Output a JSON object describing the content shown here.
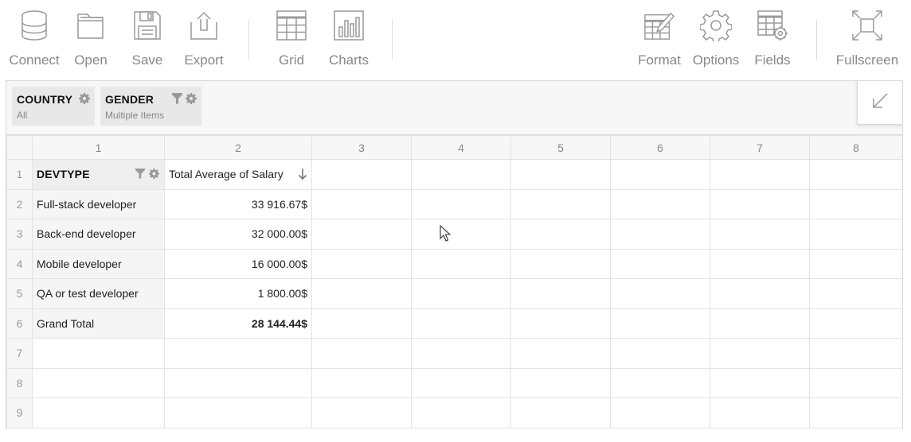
{
  "toolbar": {
    "left": [
      {
        "id": "connect",
        "label": "Connect",
        "icon": "database-icon"
      },
      {
        "id": "open",
        "label": "Open",
        "icon": "folder-icon"
      },
      {
        "id": "save",
        "label": "Save",
        "icon": "floppy-icon"
      },
      {
        "id": "export",
        "label": "Export",
        "icon": "export-icon"
      },
      {
        "id": "grid",
        "label": "Grid",
        "icon": "grid-icon"
      },
      {
        "id": "charts",
        "label": "Charts",
        "icon": "bar-chart-icon"
      }
    ],
    "right": [
      {
        "id": "format",
        "label": "Format",
        "icon": "format-icon"
      },
      {
        "id": "options",
        "label": "Options",
        "icon": "gear-icon"
      },
      {
        "id": "fields",
        "label": "Fields",
        "icon": "fields-icon"
      },
      {
        "id": "fullscreen",
        "label": "Fullscreen",
        "icon": "fullscreen-icon"
      }
    ]
  },
  "filters": [
    {
      "name": "COUNTRY",
      "value": "All",
      "has_filter": false
    },
    {
      "name": "GENDER",
      "value": "Multiple Items",
      "has_filter": true
    }
  ],
  "grid": {
    "column_numbers": [
      "1",
      "2",
      "3",
      "4",
      "5",
      "6",
      "7",
      "8"
    ],
    "row_numbers": [
      "1",
      "2",
      "3",
      "4",
      "5",
      "6",
      "7",
      "8",
      "9"
    ],
    "row_header": "DEVTYPE",
    "measure_header": "Total Average of Salary",
    "rows": [
      {
        "label": "Full-stack developer",
        "value": "33 916.67$"
      },
      {
        "label": "Back-end developer",
        "value": "32 000.00$"
      },
      {
        "label": "Mobile developer",
        "value": "16 000.00$"
      },
      {
        "label": "QA or test developer",
        "value": "1 800.00$"
      }
    ],
    "grand_total": {
      "label": "Grand Total",
      "value": "28 144.44$"
    }
  },
  "colors": {
    "accent_text": "#888888",
    "header_bg": "#f7f7f7",
    "icon": "#999999"
  }
}
